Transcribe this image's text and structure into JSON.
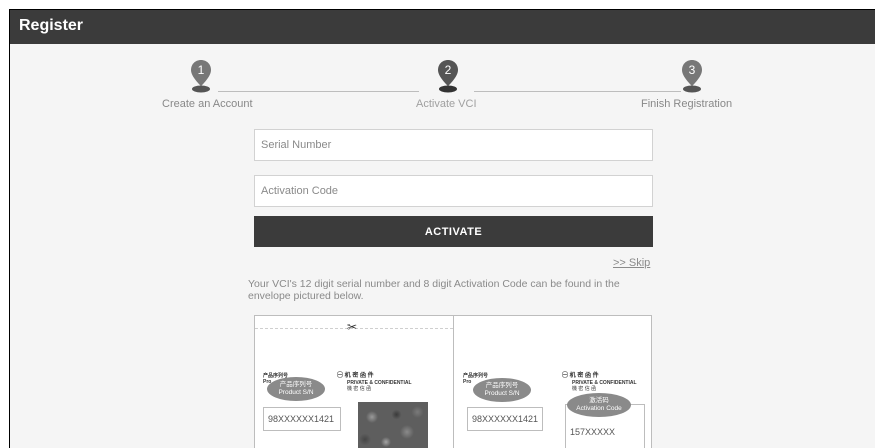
{
  "header": {
    "title": "Register"
  },
  "steps": [
    {
      "number": "1",
      "label": "Create an Account"
    },
    {
      "number": "2",
      "label": "Activate VCI"
    },
    {
      "number": "3",
      "label": "Finish Registration"
    }
  ],
  "form": {
    "serial_placeholder": "Serial Number",
    "activation_placeholder": "Activation Code",
    "activate_label": "ACTIVATE",
    "skip_label": ">> Skip",
    "hint": "Your VCI's 12 digit serial number and 8 digit Activation Code can be found in the envelope pictured below."
  },
  "envelope": {
    "scissors": "✂",
    "left": {
      "small_label": "产品序列号",
      "small_label2": "Pro",
      "bubble_cn": "产品序列号",
      "bubble_en": "Product S/N",
      "seal_cn": "㊀ 机 密 函 件",
      "seal_en": "PRIVATE & CONFIDENTIAL",
      "seal_cn2": "機 密 信 函",
      "serial_value": "98XXXXXX1421"
    },
    "right": {
      "small_label": "产品序列号",
      "small_label2": "Pro",
      "bubble_cn": "产品序列号",
      "bubble_en": "Product S/N",
      "seal_cn": "㊀ 机 密 函 件",
      "seal_en": "PRIVATE & CONFIDENTIAL",
      "seal_cn2": "機 密 信 函",
      "serial_value": "98XXXXXX1421",
      "code_bubble_cn": "激活码",
      "code_bubble_en": "Activation Code",
      "code_value": "157XXXXX"
    }
  },
  "colors": {
    "header_bg": "#3b3b3b",
    "pin": "#666666",
    "pin_active": "#444444",
    "button_bg": "#3b3b3b"
  }
}
